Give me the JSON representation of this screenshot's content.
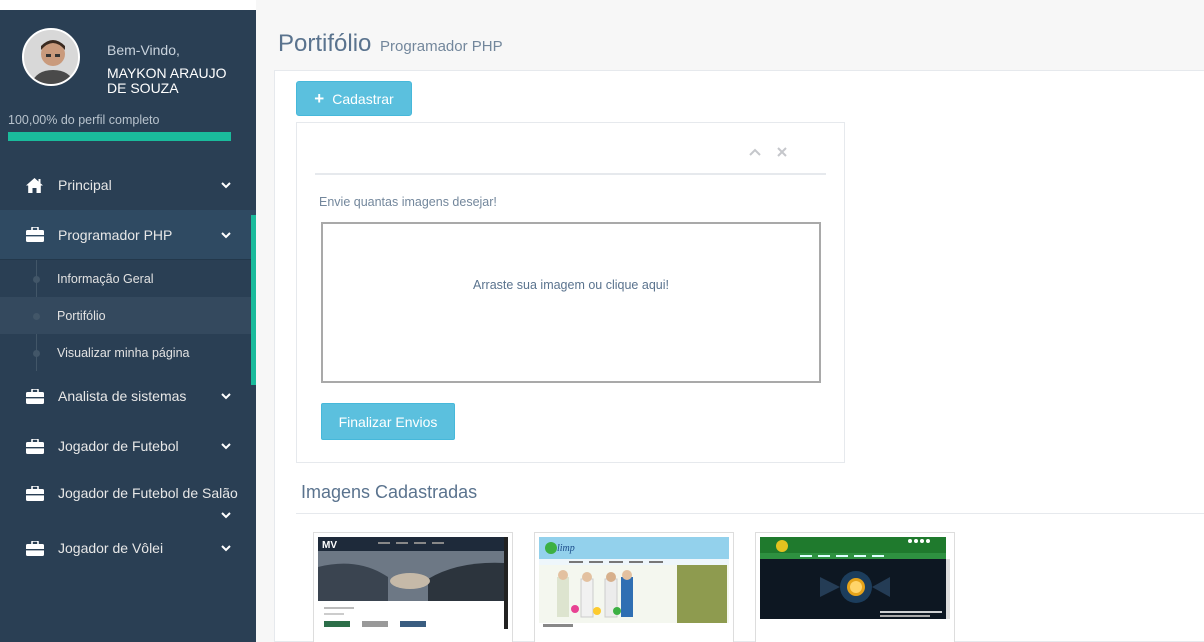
{
  "sidebar": {
    "welcome": "Bem-Vindo,",
    "username": "MAYKON ARAUJO DE SOUZA",
    "profile_completion_text": "100,00% do perfil completo",
    "profile_completion_pct": 100,
    "menu": [
      {
        "label": "Principal",
        "icon": "home-icon"
      },
      {
        "label": "Programador PHP",
        "icon": "briefcase-icon",
        "expanded": true,
        "children": [
          "Informação Geral",
          "Portifólio",
          "Visualizar minha página"
        ]
      },
      {
        "label": "Analista de sistemas",
        "icon": "briefcase-icon"
      },
      {
        "label": "Jogador de Futebol",
        "icon": "briefcase-icon"
      },
      {
        "label": "Jogador de Futebol de Salão",
        "icon": "briefcase-icon"
      },
      {
        "label": "Jogador de Vôlei",
        "icon": "briefcase-icon"
      }
    ]
  },
  "page": {
    "title": "Portifólio",
    "subtitle": "Programador PHP"
  },
  "actions": {
    "cadastrar_label": "Cadastrar"
  },
  "upload": {
    "hint": "Envie quantas imagens desejar!",
    "dropzone_text": "Arraste sua imagem ou clique aqui!",
    "finalize_label": "Finalizar Envios",
    "tools": {
      "collapse_icon": "chevron-up-icon",
      "close_icon": "close-icon"
    }
  },
  "gallery": {
    "title": "Imagens Cadastradas",
    "items": [
      {
        "logo_text": "MV"
      },
      {
        "logo_text": "limp"
      },
      {
        "logo_text": ""
      }
    ]
  },
  "colors": {
    "sidebar_bg": "#2a3f54",
    "accent": "#1abb9c",
    "info_button": "#5bc0de",
    "title_text": "#5a738e"
  }
}
